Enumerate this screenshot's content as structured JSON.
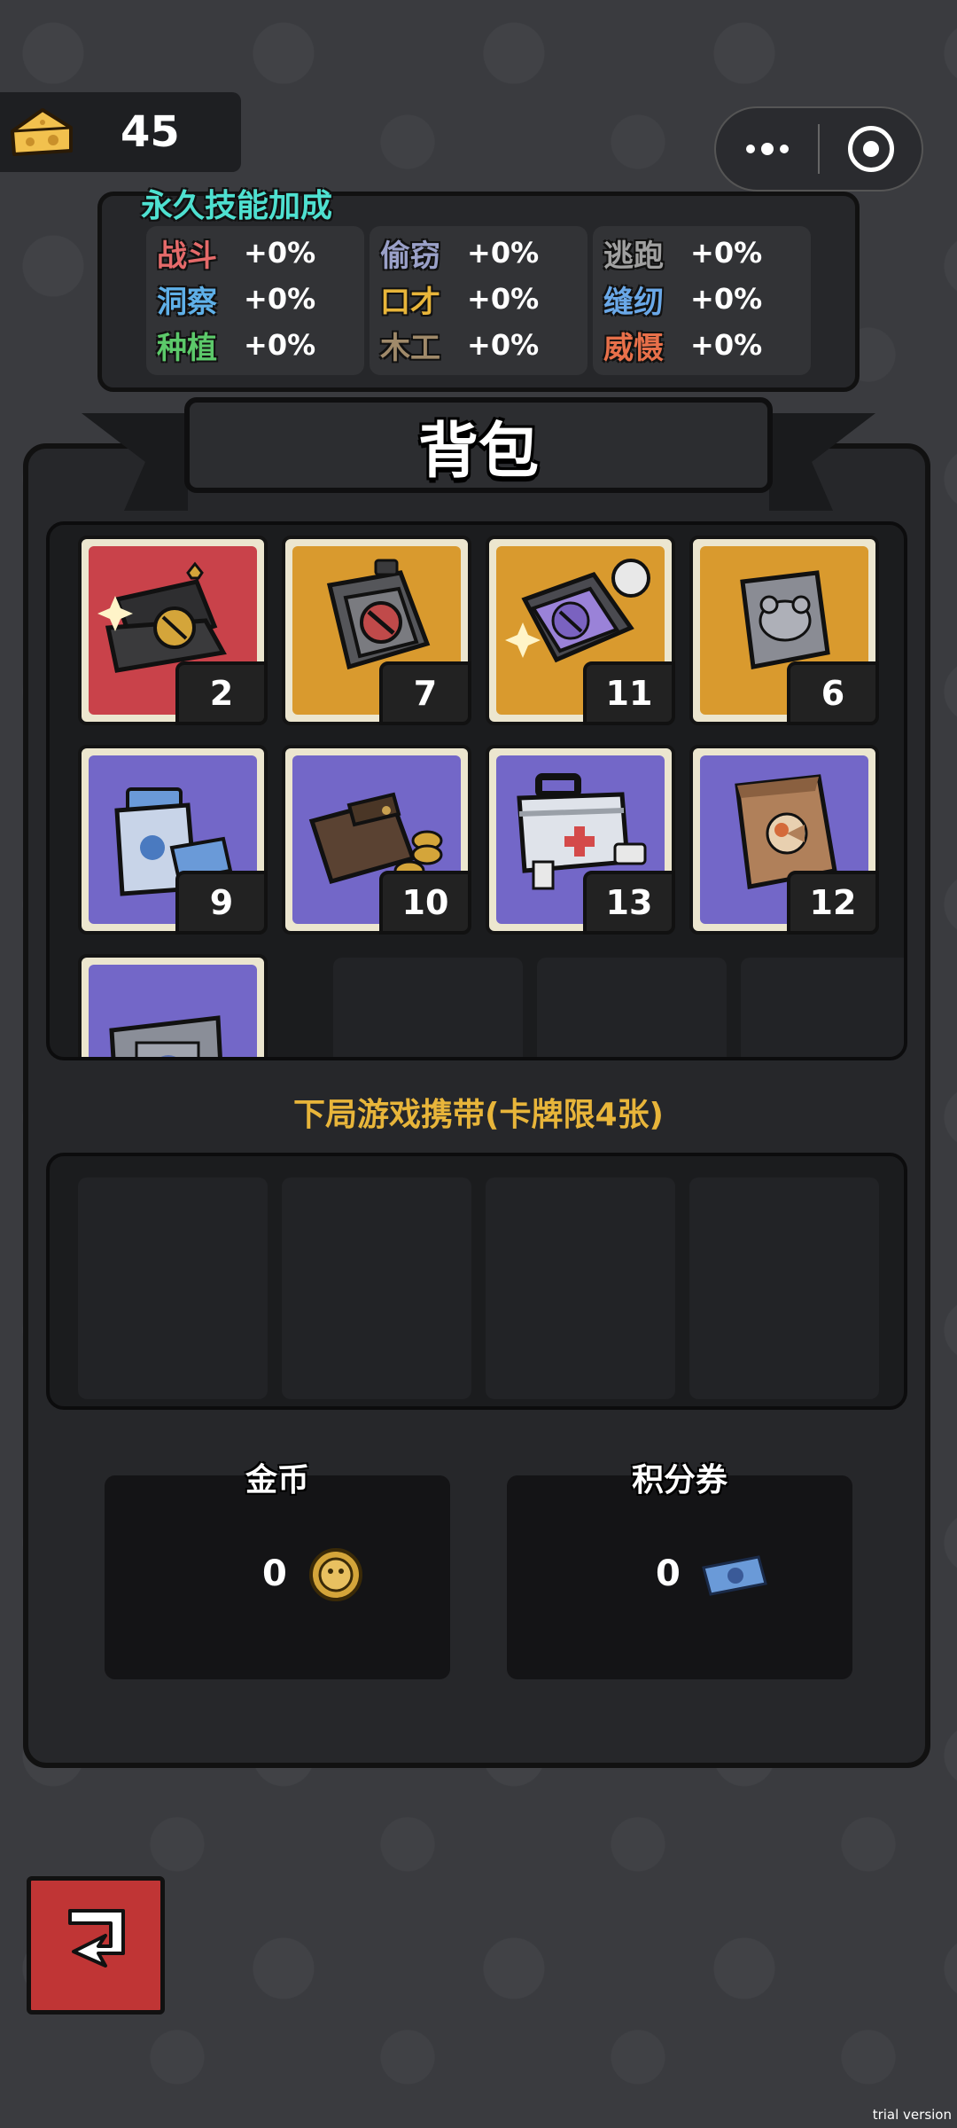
{
  "cheese": {
    "count": "45",
    "icon": "cheese-icon"
  },
  "capsule": {
    "more_icon": "more-dots-icon",
    "close_icon": "target-close-icon"
  },
  "skills": {
    "title": "永久技能加成",
    "columns": [
      [
        {
          "name": "战斗",
          "value": "+0%",
          "color": "#e56a6a"
        },
        {
          "name": "洞察",
          "value": "+0%",
          "color": "#5fb0e8"
        },
        {
          "name": "种植",
          "value": "+0%",
          "color": "#5cc96a"
        }
      ],
      [
        {
          "name": "偷窃",
          "value": "+0%",
          "color": "#9aa0c8"
        },
        {
          "name": "口才",
          "value": "+0%",
          "color": "#e8b53a"
        },
        {
          "name": "木工",
          "value": "+0%",
          "color": "#a08a6a"
        }
      ],
      [
        {
          "name": "逃跑",
          "value": "+0%",
          "color": "#a0a0a0"
        },
        {
          "name": "缝纫",
          "value": "+0%",
          "color": "#6aa8e8"
        },
        {
          "name": "威慑",
          "value": "+0%",
          "color": "#e8704a"
        }
      ]
    ]
  },
  "backpack": {
    "title": "背包",
    "items": [
      {
        "name": "gift-box-icon",
        "count": "2",
        "bg": "#c9424a"
      },
      {
        "name": "sealed-package-icon",
        "count": "7",
        "bg": "#d99a2e"
      },
      {
        "name": "purple-chest-icon",
        "count": "11",
        "bg": "#d99a2e"
      },
      {
        "name": "stone-tablet-icon",
        "count": "6",
        "bg": "#d99a2e"
      },
      {
        "name": "shopping-bag-tickets-icon",
        "count": "9",
        "bg": "#7367c8"
      },
      {
        "name": "wallet-coins-icon",
        "count": "10",
        "bg": "#7367c8"
      },
      {
        "name": "first-aid-kit-icon",
        "count": "13",
        "bg": "#7367c8"
      },
      {
        "name": "paper-bag-icon",
        "count": "12",
        "bg": "#7367c8"
      },
      {
        "name": "metal-case-icon",
        "count": "",
        "bg": "#7367c8"
      }
    ]
  },
  "carry": {
    "label": "下局游戏携带(卡牌限4张)"
  },
  "currency": {
    "gold": {
      "label": "金币",
      "value": "0",
      "icon": "gold-coin-icon"
    },
    "points": {
      "label": "积分券",
      "value": "0",
      "icon": "ticket-icon"
    }
  },
  "back_button": {
    "icon": "return-arrow-icon"
  },
  "watermark": "trial version"
}
